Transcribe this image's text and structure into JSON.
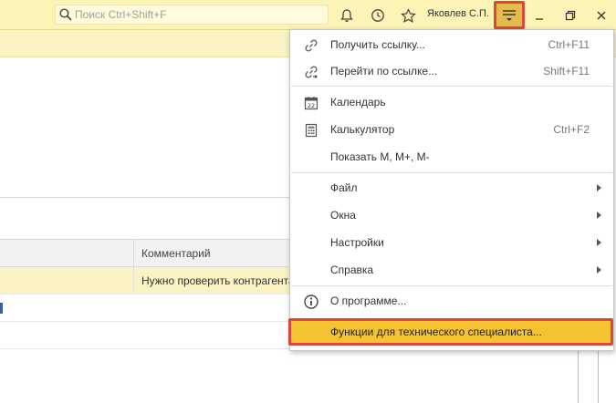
{
  "header": {
    "search_placeholder": "Поиск Ctrl+Shift+F",
    "user_name": "Яковлев С.П."
  },
  "table": {
    "column_comment": "Комментарий",
    "row_comment": "Нужно проверить контрагента"
  },
  "menu": {
    "get_link": {
      "label": "Получить ссылку...",
      "shortcut": "Ctrl+F11"
    },
    "goto_link": {
      "label": "Перейти по ссылке...",
      "shortcut": "Shift+F11"
    },
    "calendar": {
      "label": "Календарь",
      "icon_text": "22"
    },
    "calculator": {
      "label": "Калькулятор",
      "shortcut": "Ctrl+F2"
    },
    "show_m": {
      "label": "Показать М, М+, М-"
    },
    "file": {
      "label": "Файл"
    },
    "windows": {
      "label": "Окна"
    },
    "settings": {
      "label": "Настройки"
    },
    "help": {
      "label": "Справка"
    },
    "about": {
      "label": "О программе..."
    },
    "tech_functions": {
      "label": "Функции для технического специалиста..."
    }
  },
  "colors": {
    "title_bg": "#fbf4b6",
    "highlight": "#f5c332",
    "red_frame": "#d9483f"
  }
}
